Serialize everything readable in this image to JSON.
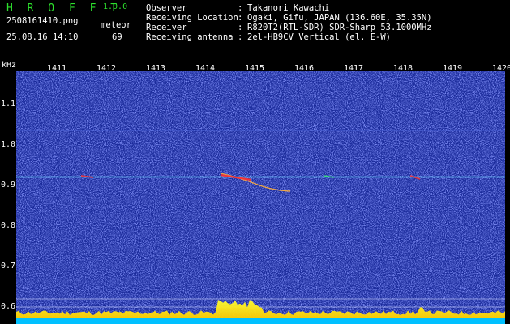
{
  "app": {
    "name": "H R O F F T",
    "version": "1.0.0"
  },
  "file": {
    "name": "2508161410.png",
    "datetime": "25.08.16 14:10"
  },
  "meteor": {
    "label": "meteor",
    "count": "69"
  },
  "info": [
    {
      "key": "Observer",
      "value": "Takanori Kawachi"
    },
    {
      "key": "Receiving Location",
      "value": "Ogaki, Gifu, JAPAN (136.60E, 35.35N)"
    },
    {
      "key": "Receiver",
      "value": "R820T2(RTL-SDR) SDR-Sharp 53.1000MHz"
    },
    {
      "key": "Receiving antenna",
      "value": "2el-HB9CV Vertical (el. E-W)"
    }
  ],
  "axis": {
    "y_unit": "kHz",
    "y_ticks": [
      "1.1",
      "1.0",
      "0.9",
      "0.8",
      "0.7",
      "0.6"
    ],
    "x_ticks": [
      "1411",
      "1412",
      "1413",
      "1414",
      "1415",
      "1416",
      "1417",
      "1418",
      "1419",
      "1420"
    ]
  },
  "colors": {
    "background": "#000000",
    "spectrogram": "#1a2a9a",
    "title_green": "#2de02d",
    "carrier": "#6fe0ff",
    "meteor_head": "#ff3030",
    "baseline": "#ffff00",
    "floor": "#00c0ff"
  }
}
